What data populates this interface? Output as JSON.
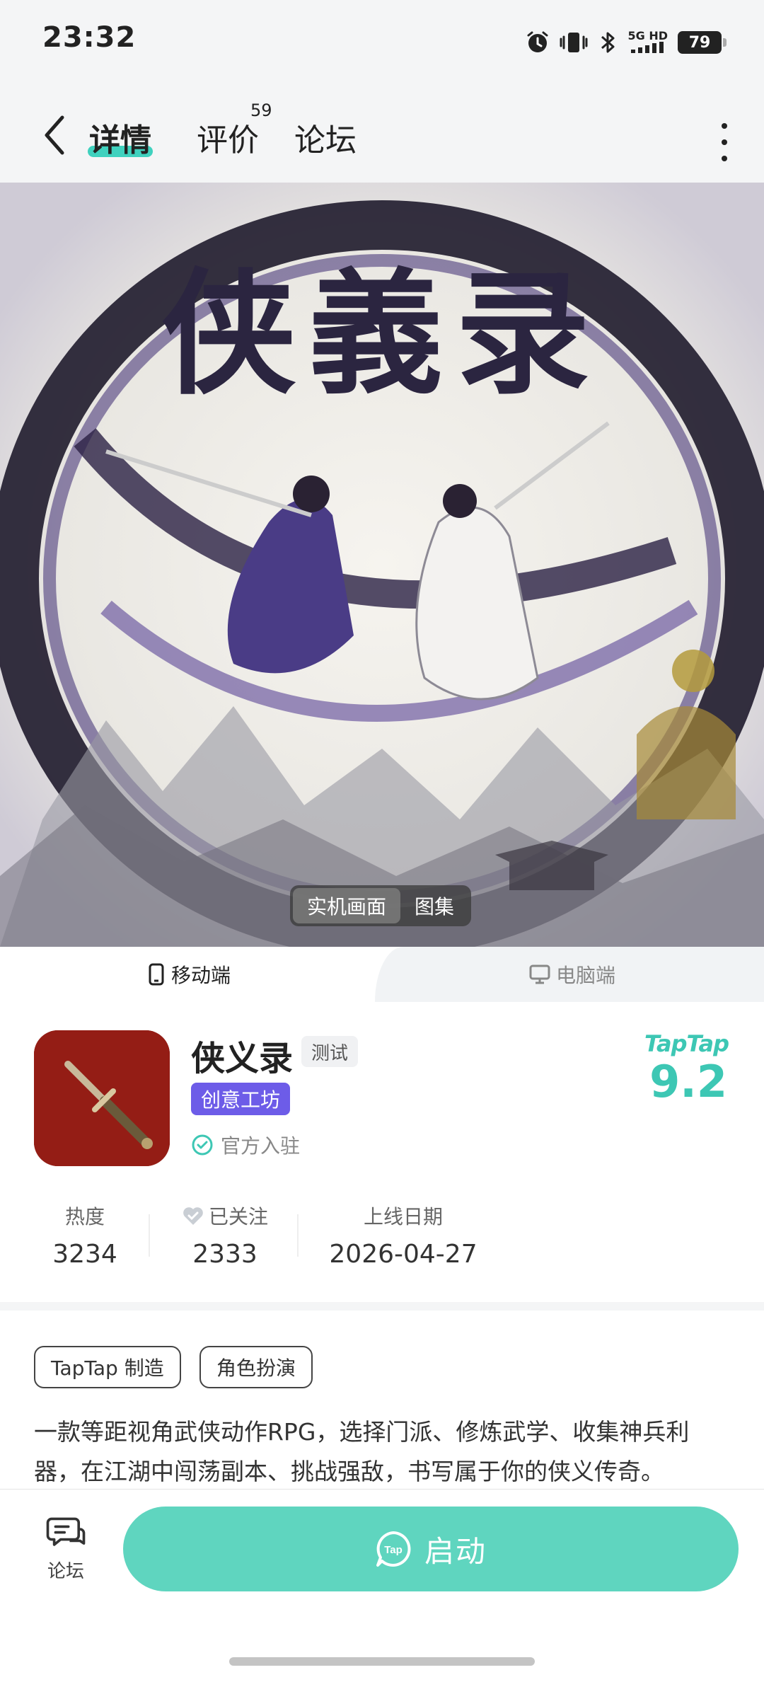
{
  "status_bar": {
    "time": "23:32",
    "network_top": "5G HD",
    "battery": "79"
  },
  "nav": {
    "tabs": [
      {
        "label": "详情",
        "active": true
      },
      {
        "label": "评价"
      },
      {
        "label": "论坛"
      }
    ],
    "review_count": "59"
  },
  "hero": {
    "title_art": "侠義录",
    "segments": [
      {
        "label": "实机画面",
        "active": true
      },
      {
        "label": "图集"
      }
    ]
  },
  "platform_tabs": {
    "mobile": "移动端",
    "pc": "电脑端"
  },
  "app": {
    "name": "侠义录",
    "test_tag": "测试",
    "workshop_tag": "创意工坊",
    "official": "官方入驻",
    "rating_brand": "TapTap",
    "rating": "9.2"
  },
  "stats": {
    "hot_label": "热度",
    "hot_value": "3234",
    "follow_label": "已关注",
    "follow_value": "2333",
    "date_label": "上线日期",
    "date_value": "2026-04-27"
  },
  "tags": [
    "TapTap 制造",
    "角色扮演"
  ],
  "description": "一款等距视角武侠动作RPG，选择门派、修炼武学、收集神兵利器，在江湖中闯荡副本、挑战强敌，书写属于你的侠义传奇。",
  "bottom": {
    "forum_label": "论坛",
    "launch_label": "启动",
    "launch_icon_text": "Tap"
  },
  "colors": {
    "accent": "#3fd1be",
    "launch": "#5fd5bf",
    "workshop": "#6d5ce8"
  }
}
